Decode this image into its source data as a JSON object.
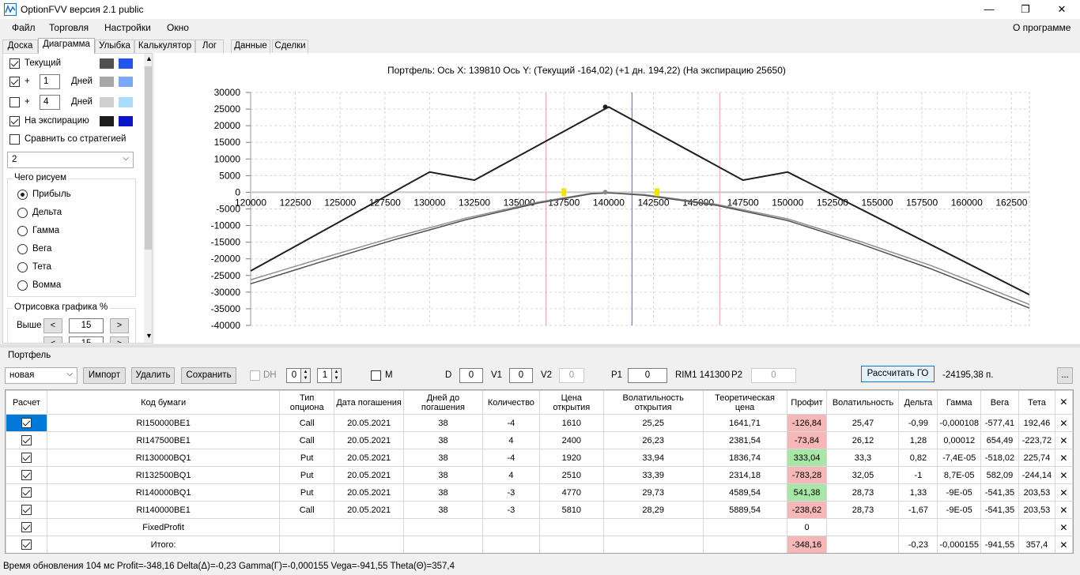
{
  "window": {
    "title": "OptionFVV версия 2.1 public",
    "minimize": "—",
    "maximize": "❐",
    "close": "✕"
  },
  "menu": {
    "items": [
      "Файл",
      "Торговля",
      "Настройки",
      "Окно"
    ],
    "about": "О программе"
  },
  "tabs": [
    "Доска",
    "Диаграмма",
    "Улыбка",
    "Калькулятор",
    "Лог",
    "Данные",
    "Сделки"
  ],
  "active_tab": "Диаграмма",
  "left": {
    "current_label": "Текущий",
    "plus": "+",
    "days_label": "Дней",
    "days1": "1",
    "days2": "4",
    "expiry_label": "На экспирацию",
    "compare_label": "Сравнить со стратегией",
    "strategy_value": "2",
    "draw_group": "Чего рисуем",
    "radios": [
      "Прибыль",
      "Дельта",
      "Гамма",
      "Вега",
      "Тета",
      "Вомма"
    ],
    "render_group": "Отрисовка графика %",
    "above_label": "Выше",
    "above_value": "15",
    "below_value": "15",
    "colors": {
      "current_dark": "#505050",
      "current_light": "#2255ee",
      "plus1_dark": "#a8a8a8",
      "plus1_light": "#7aa8f8",
      "plus2_dark": "#cfcfcf",
      "plus2_light": "#aadcff",
      "expiry_dark": "#1e1e1e",
      "expiry_light": "#0a14c8"
    }
  },
  "chart_header": "Портфель:  Ось X:  139810  Ось Y:   (Текущий -164,02)   (+1 дн. 194,22)   (На экспирацию 25650)",
  "chart_data": {
    "type": "line",
    "x_ticks": [
      120000,
      122500,
      125000,
      127500,
      130000,
      132500,
      135000,
      137500,
      140000,
      142500,
      145000,
      147500,
      150000,
      152500,
      155000,
      157500,
      160000,
      162500
    ],
    "y_ticks": [
      30000,
      25000,
      20000,
      15000,
      10000,
      5000,
      0,
      -5000,
      -10000,
      -15000,
      -20000,
      -25000,
      -30000,
      -35000,
      -40000
    ],
    "xlim": [
      120000,
      163500
    ],
    "ylim": [
      -40000,
      30000
    ],
    "grid": true,
    "vertical_lines": [
      {
        "x": 136500,
        "color": "#f4a0a8"
      },
      {
        "x": 141300,
        "color": "#5a6a9a"
      },
      {
        "x": 146200,
        "color": "#f4a0a8"
      }
    ],
    "series": [
      {
        "x": [
          120000,
          130000,
          132500,
          140000,
          147500,
          150000,
          163500
        ],
        "y": [
          -23640,
          6080,
          3640,
          25650,
          3640,
          6080,
          -30780
        ],
        "color": "#1e1e1e"
      },
      {
        "x": [
          120000,
          124000,
          128000,
          132000,
          136000,
          139000,
          140000,
          142000,
          146000,
          150000,
          154000,
          158000,
          163500
        ],
        "y": [
          -26300,
          -19800,
          -13500,
          -7800,
          -3000,
          -350,
          -200,
          -700,
          -3600,
          -8000,
          -14700,
          -22000,
          -33700
        ],
        "color": "#909090"
      },
      {
        "x": [
          120000,
          124000,
          128000,
          132000,
          136000,
          139000,
          140000,
          142000,
          146000,
          150000,
          154000,
          158000,
          163500
        ],
        "y": [
          -27500,
          -20800,
          -14300,
          -8300,
          -3300,
          -500,
          -164,
          -900,
          -3900,
          -8500,
          -15400,
          -23000,
          -34800
        ],
        "color": "#505050"
      }
    ],
    "point": {
      "x": 139810,
      "y": 25650
    }
  },
  "portfolio": {
    "label": "Портфель",
    "name": "новая",
    "buttons": {
      "import": "Импорт",
      "delete": "Удалить",
      "save": "Сохранить",
      "calc": "Рассчитать ГО",
      "more": "..."
    },
    "dh_label": "DH",
    "dh1": "0",
    "dh2": "1",
    "m_label": "M",
    "d_label": "D",
    "d_value": "0",
    "v1_label": "V1",
    "v1_value": "0",
    "v2_label": "V2",
    "v2_value": "0",
    "p1_label": "P1",
    "p1_value": "0",
    "rim_label": "RIM1 141300",
    "p2_label": "P2",
    "p2_value": "0",
    "go_value": "-24195,38 п."
  },
  "table": {
    "headers": [
      "Расчет",
      "Код бумаги",
      "Тип опциона",
      "Дата погашения",
      "Дней до погашения",
      "Количество",
      "Цена открытия",
      "Волатильность открытия",
      "Теоретическая цена",
      "Профит",
      "Волатильность",
      "Дельта",
      "Гамма",
      "Вега",
      "Тета"
    ],
    "rows": [
      {
        "code": "RI150000BE1",
        "type": "Call",
        "date": "20.05.2021",
        "days": "38",
        "qty": "-4",
        "open": "1610",
        "vol_open": "25,25",
        "theo": "1641,71",
        "profit": "-126,84",
        "pclass": "neg",
        "vol": "25,47",
        "delta": "-0,99",
        "gamma": "-0,000108",
        "vega": "-577,41",
        "theta": "192,46"
      },
      {
        "code": "RI147500BE1",
        "type": "Call",
        "date": "20.05.2021",
        "days": "38",
        "qty": "4",
        "open": "2400",
        "vol_open": "26,23",
        "theo": "2381,54",
        "profit": "-73,84",
        "pclass": "neg",
        "vol": "26,12",
        "delta": "1,28",
        "gamma": "0,00012",
        "vega": "654,49",
        "theta": "-223,72"
      },
      {
        "code": "RI130000BQ1",
        "type": "Put",
        "date": "20.05.2021",
        "days": "38",
        "qty": "-4",
        "open": "1920",
        "vol_open": "33,94",
        "theo": "1836,74",
        "profit": "333,04",
        "pclass": "pos",
        "vol": "33,3",
        "delta": "0,82",
        "gamma": "-7,4E-05",
        "vega": "-518,02",
        "theta": "225,74"
      },
      {
        "code": "RI132500BQ1",
        "type": "Put",
        "date": "20.05.2021",
        "days": "38",
        "qty": "4",
        "open": "2510",
        "vol_open": "33,39",
        "theo": "2314,18",
        "profit": "-783,28",
        "pclass": "neg",
        "vol": "32,05",
        "delta": "-1",
        "gamma": "8,7E-05",
        "vega": "582,09",
        "theta": "-244,14"
      },
      {
        "code": "RI140000BQ1",
        "type": "Put",
        "date": "20.05.2021",
        "days": "38",
        "qty": "-3",
        "open": "4770",
        "vol_open": "29,73",
        "theo": "4589,54",
        "profit": "541,38",
        "pclass": "pos",
        "vol": "28,73",
        "delta": "1,33",
        "gamma": "-9E-05",
        "vega": "-541,35",
        "theta": "203,53"
      },
      {
        "code": "RI140000BE1",
        "type": "Call",
        "date": "20.05.2021",
        "days": "38",
        "qty": "-3",
        "open": "5810",
        "vol_open": "28,29",
        "theo": "5889,54",
        "profit": "-238,62",
        "pclass": "neg",
        "vol": "28,73",
        "delta": "-1,67",
        "gamma": "-9E-05",
        "vega": "-541,35",
        "theta": "203,53"
      },
      {
        "code": "FixedProfit",
        "type": "",
        "date": "",
        "days": "",
        "qty": "",
        "open": "",
        "vol_open": "",
        "theo": "",
        "profit": "0",
        "pclass": "",
        "vol": "",
        "delta": "",
        "gamma": "",
        "vega": "",
        "theta": ""
      },
      {
        "code": "Итого:",
        "type": "",
        "date": "",
        "days": "",
        "qty": "",
        "open": "",
        "vol_open": "",
        "theo": "",
        "profit": "-348,16",
        "pclass": "neg",
        "vol": "",
        "delta": "-0,23",
        "gamma": "-0,000155",
        "vega": "-941,55",
        "theta": "357,4"
      }
    ]
  },
  "status": "Время обновления 104 мс  Profit=-348,16 Delta(Δ)=-0,23 Gamma(Γ)=-0,000155 Vega=-941,55 Theta(Θ)=357,4"
}
